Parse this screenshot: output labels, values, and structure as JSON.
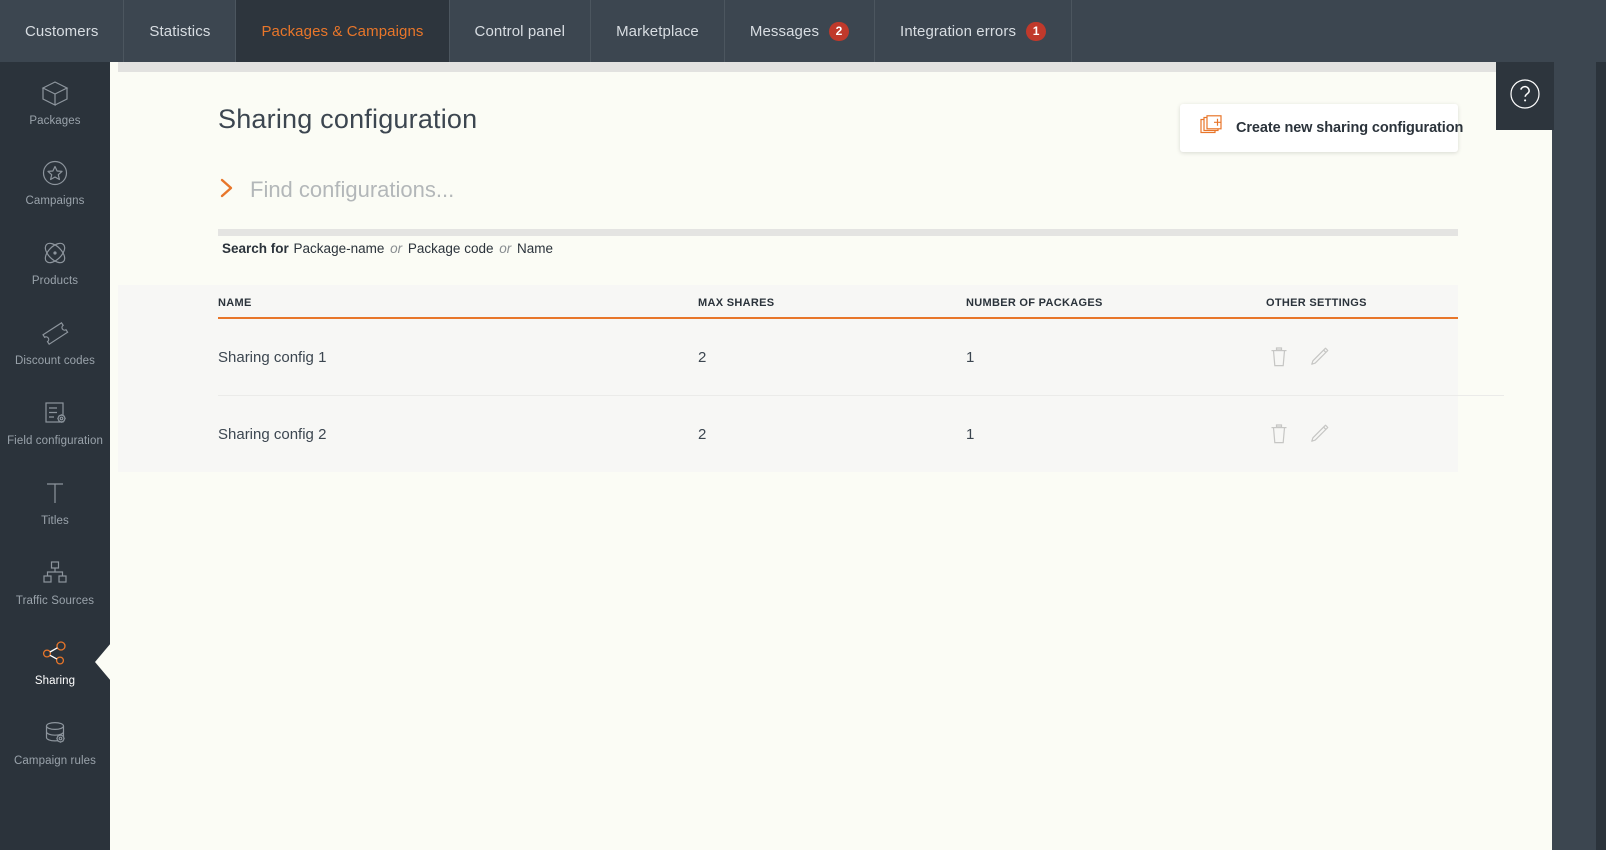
{
  "topnav": {
    "tabs": [
      {
        "label": "Customers",
        "badge": null,
        "active": false
      },
      {
        "label": "Statistics",
        "badge": null,
        "active": false
      },
      {
        "label": "Packages & Campaigns",
        "badge": null,
        "active": true
      },
      {
        "label": "Control panel",
        "badge": null,
        "active": false
      },
      {
        "label": "Marketplace",
        "badge": null,
        "active": false
      },
      {
        "label": "Messages",
        "badge": "2",
        "active": false
      },
      {
        "label": "Integration errors",
        "badge": "1",
        "active": false
      }
    ]
  },
  "sidebar": {
    "items": [
      {
        "label": "Packages",
        "icon": "box-icon",
        "active": false
      },
      {
        "label": "Campaigns",
        "icon": "star-circle-icon",
        "active": false
      },
      {
        "label": "Products",
        "icon": "atom-icon",
        "active": false
      },
      {
        "label": "Discount codes",
        "icon": "ticket-icon",
        "active": false
      },
      {
        "label": "Field configuration",
        "icon": "list-gear-icon",
        "active": false
      },
      {
        "label": "Titles",
        "icon": "text-t-icon",
        "active": false
      },
      {
        "label": "Traffic Sources",
        "icon": "sitemap-icon",
        "active": false
      },
      {
        "label": "Sharing",
        "icon": "share-nodes-icon",
        "active": true
      },
      {
        "label": "Campaign rules",
        "icon": "database-gear-icon",
        "active": false
      }
    ]
  },
  "help": {
    "icon": "question-circle-icon",
    "label": "?"
  },
  "main": {
    "title": "Sharing configuration",
    "create_button": {
      "label": "Create new sharing configuration",
      "icon": "copy-plus-icon"
    },
    "search": {
      "chevron_icon": "chevron-right-icon",
      "value": "",
      "placeholder": "Find configurations..."
    },
    "search_hint": {
      "prefix": "Search for",
      "term1": "Package-name",
      "or1": "or",
      "term2": "Package code",
      "or2": "or",
      "term3": "Name"
    },
    "table": {
      "columns": [
        "NAME",
        "MAX SHARES",
        "NUMBER OF PACKAGES",
        "OTHER SETTINGS"
      ],
      "rows": [
        {
          "name": "Sharing config 1",
          "max_shares": "2",
          "number_of_packages": "1",
          "actions": [
            "trash-icon",
            "pencil-icon"
          ]
        },
        {
          "name": "Sharing config 2",
          "max_shares": "2",
          "number_of_packages": "1",
          "actions": [
            "trash-icon",
            "pencil-icon"
          ]
        }
      ]
    }
  },
  "colors": {
    "accent": "#e8762a",
    "nav_bg": "#3c4650",
    "sidebar_bg": "#2b333b",
    "badge_red": "#c0392b",
    "page_bg": "#fbfcf5",
    "table_bg": "#f7f7f5"
  }
}
